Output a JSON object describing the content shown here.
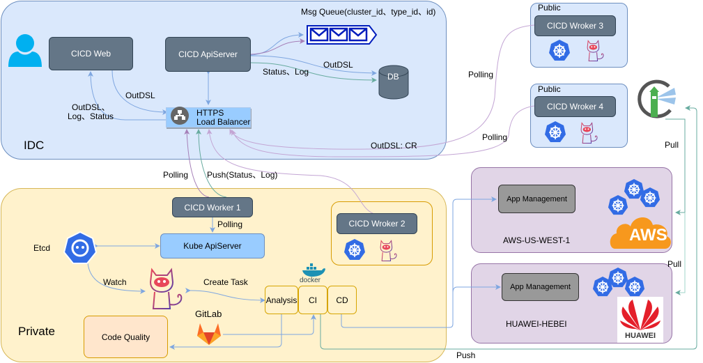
{
  "diagram": {
    "regions": {
      "idc": "IDC",
      "private": "Private",
      "public_3": "Public",
      "public_4": "Public",
      "aws": "AWS-US-WEST-1",
      "huawei": "HUAWEI-HEBEI"
    },
    "nodes": {
      "cicd_web": "CICD Web",
      "cicd_apiserver": "CICD ApiServer",
      "msg_queue": "Msg Queue(cluster_id、type_id、id)",
      "db": "DB",
      "lb_line1": "HTTPS",
      "lb_line2": "Load Balancer",
      "worker1": "CICD Worker 1",
      "worker2": "CICD Wroker 2",
      "worker3": "CICD Wroker 3",
      "worker4": "CICD Wroker 4",
      "kube_apiserver": "Kube ApiServer",
      "etcd": "Etcd",
      "analysis": "Analysis",
      "ci": "CI",
      "cd": "CD",
      "code_quality": "Code Quality",
      "gitlab": "GitLab",
      "docker": "docker",
      "app_mgmt_aws": "App Management",
      "app_mgmt_huawei": "App Management",
      "aws_logo": "AWS",
      "huawei_logo": "HUAWEI"
    },
    "edge_labels": {
      "web_to_lb": "OutDSL",
      "lb_to_web_1": "OutDSL、",
      "lb_to_web_2": "Log、Status",
      "api_to_db_status": "Status、Log",
      "api_to_db_outdsl": "OutDSL",
      "outdsl_cr": "OutDSL: CR",
      "polling_w3": "Polling",
      "polling_w4": "Polling",
      "polling_w1": "Polling",
      "push_w2": "Push(Status、Log)",
      "polling_kube": "Polling",
      "watch": "Watch",
      "create_task": "Create Task",
      "pull_1": "Pull",
      "pull_2": "Pull",
      "push_harbor": "Push"
    },
    "colors": {
      "idc_fill": "#dae8fc",
      "private_fill": "#fff2cc",
      "cloud_fill": "#e1d5e7",
      "dark_node": "#647687",
      "blue_edge": "#7ea6e0",
      "purple_edge": "#a680b8",
      "green_edge": "#67ab9f"
    }
  }
}
